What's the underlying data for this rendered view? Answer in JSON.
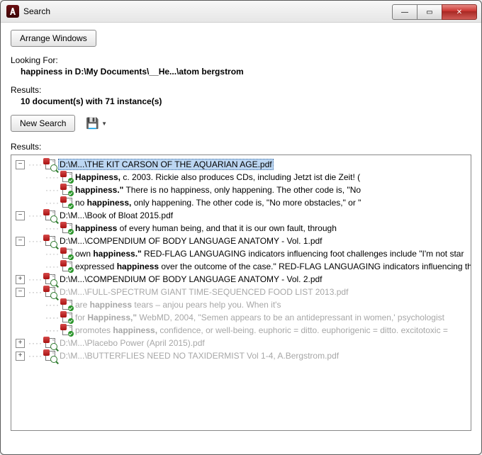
{
  "window": {
    "title": "Search"
  },
  "buttons": {
    "arrange": "Arrange Windows",
    "new_search": "New Search"
  },
  "looking_for": {
    "label": "Looking For:",
    "value": "happiness in D:\\My Documents\\__He...\\atom bergstrom"
  },
  "results_summary": {
    "label": "Results:",
    "value": "10 document(s) with 71 instance(s)"
  },
  "results_label": "Results:",
  "tree": [
    {
      "expanded": true,
      "selected": true,
      "grey": false,
      "title": "D:\\M...\\THE KIT CARSON OF THE AQUARIAN AGE.pdf",
      "hits": [
        {
          "pre": "",
          "bold": "Happiness,",
          "post": " c. 2003. Rickie also produces CDs, including Jetzt ist die Zeit! ("
        },
        {
          "pre": "",
          "bold": "happiness.\"",
          "post": "  There is no happiness, only happening. The other code is, \"No"
        },
        {
          "pre": "no ",
          "bold": "happiness,",
          "post": " only happening. The other code is, \"No more obstacles,\" or \""
        }
      ]
    },
    {
      "expanded": true,
      "selected": false,
      "grey": false,
      "title": "D:\\M...\\Book of Bloat 2015.pdf",
      "hits": [
        {
          "pre": "",
          "bold": "happiness",
          "post": " of every human being, and that it is our own fault, through"
        }
      ]
    },
    {
      "expanded": true,
      "selected": false,
      "grey": false,
      "title": "D:\\M...\\COMPENDIUM OF BODY LANGUAGE ANATOMY - Vol. 1.pdf",
      "hits": [
        {
          "pre": "own ",
          "bold": "happiness.\"",
          "post": "  RED-FLAG LANGUAGING indicators influencing foot challenges include \"I'm not star"
        },
        {
          "pre": "expressed ",
          "bold": "happiness",
          "post": " over the outcome of the case.\" RED-FLAG LANGUAGING indicators influencing th"
        }
      ]
    },
    {
      "expanded": false,
      "selected": false,
      "grey": false,
      "title": "D:\\M...\\COMPENDIUM OF BODY LANGUAGE ANATOMY - Vol. 2.pdf",
      "hits": []
    },
    {
      "expanded": true,
      "selected": false,
      "grey": true,
      "title": "D:\\M...\\FULL-SPECTRUM GIANT TIME-SEQUENCED FOOD LIST 2013.pdf",
      "hits": [
        {
          "pre": "are ",
          "bold": "happiness",
          "post": " tears – anjou pears help you. When it's"
        },
        {
          "pre": "for ",
          "bold": "Happiness,\"",
          "post": " WebMD, 2004, \"Semen appears to be an antidepressant in women,' psychologist"
        },
        {
          "pre": "promotes ",
          "bold": "happiness,",
          "post": " confidence, or well-being. euphoric = ditto. euphorigenic = ditto. excitotoxic ="
        }
      ]
    },
    {
      "expanded": false,
      "selected": false,
      "grey": true,
      "title": "D:\\M...\\Placebo Power (April 2015).pdf",
      "hits": []
    },
    {
      "expanded": false,
      "selected": false,
      "grey": true,
      "title": "D:\\M...\\BUTTERFLIES NEED NO TAXIDERMIST Vol 1-4, A.Bergstrom.pdf",
      "hits": []
    }
  ]
}
